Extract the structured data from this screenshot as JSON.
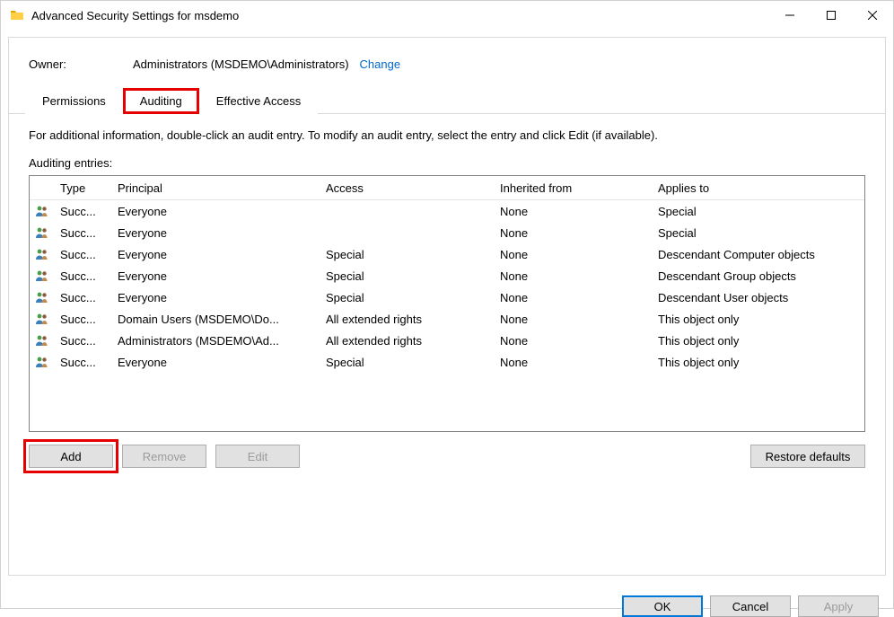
{
  "window": {
    "title": "Advanced Security Settings for msdemo"
  },
  "owner": {
    "label": "Owner:",
    "value": "Administrators (MSDEMO\\Administrators)",
    "change": "Change"
  },
  "tabs": {
    "permissions": "Permissions",
    "auditing": "Auditing",
    "effective": "Effective Access"
  },
  "info_text": "For additional information, double-click an audit entry. To modify an audit entry, select the entry and click Edit (if available).",
  "entries_label": "Auditing entries:",
  "columns": {
    "type": "Type",
    "principal": "Principal",
    "access": "Access",
    "inherited": "Inherited from",
    "applies": "Applies to"
  },
  "rows": [
    {
      "type": "Succ...",
      "principal": "Everyone",
      "access": "",
      "inherited": "None",
      "applies": "Special"
    },
    {
      "type": "Succ...",
      "principal": "Everyone",
      "access": "",
      "inherited": "None",
      "applies": "Special"
    },
    {
      "type": "Succ...",
      "principal": "Everyone",
      "access": "Special",
      "inherited": "None",
      "applies": "Descendant Computer objects"
    },
    {
      "type": "Succ...",
      "principal": "Everyone",
      "access": "Special",
      "inherited": "None",
      "applies": "Descendant Group objects"
    },
    {
      "type": "Succ...",
      "principal": "Everyone",
      "access": "Special",
      "inherited": "None",
      "applies": "Descendant User objects"
    },
    {
      "type": "Succ...",
      "principal": "Domain Users (MSDEMO\\Do...",
      "access": "All extended rights",
      "inherited": "None",
      "applies": "This object only"
    },
    {
      "type": "Succ...",
      "principal": "Administrators (MSDEMO\\Ad...",
      "access": "All extended rights",
      "inherited": "None",
      "applies": "This object only"
    },
    {
      "type": "Succ...",
      "principal": "Everyone",
      "access": "Special",
      "inherited": "None",
      "applies": "This object only"
    }
  ],
  "buttons": {
    "add": "Add",
    "remove": "Remove",
    "edit": "Edit",
    "restore": "Restore defaults",
    "ok": "OK",
    "cancel": "Cancel",
    "apply": "Apply"
  }
}
